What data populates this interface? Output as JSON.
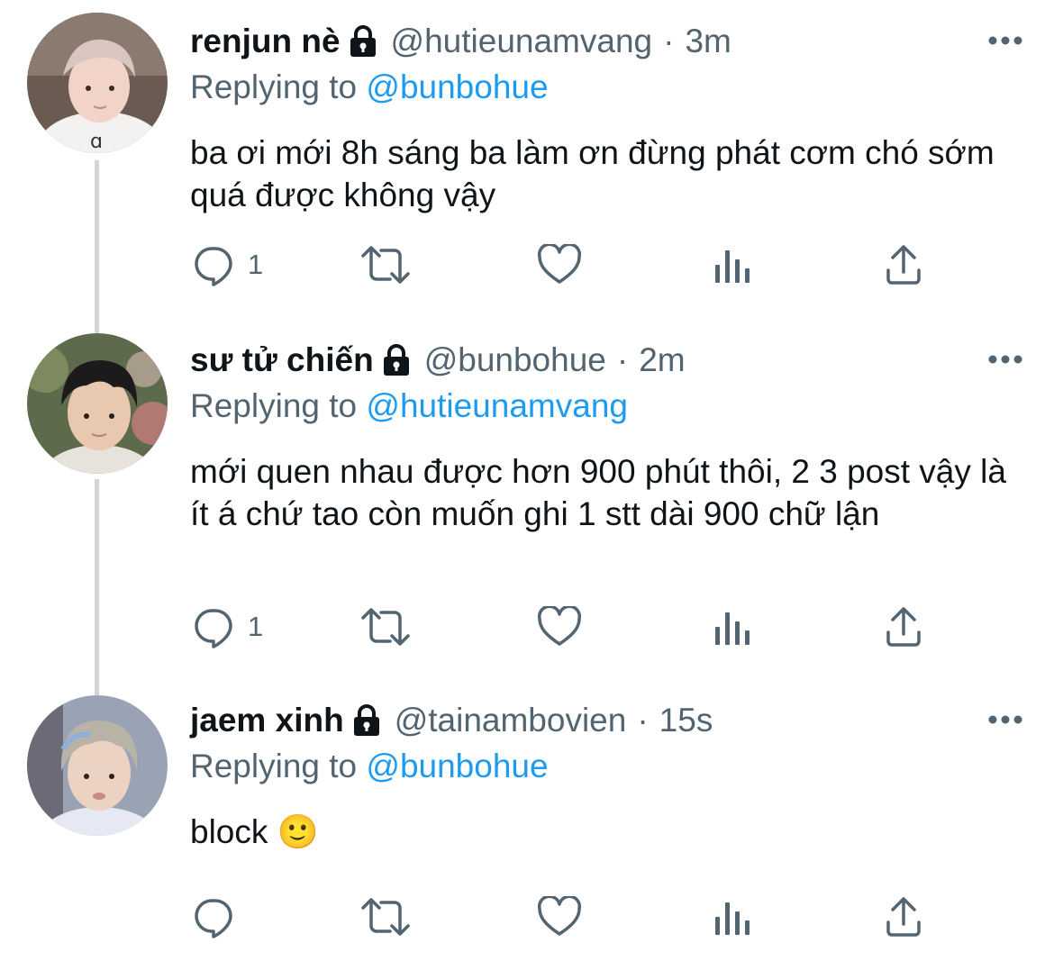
{
  "tweets": [
    {
      "display_name": "renjun nè",
      "handle": "@hutieunamvang",
      "dot": "·",
      "time": "3m",
      "replying_prefix": "Replying to",
      "replying_to": "@bunbohue",
      "text": "ba ơi mới 8h sáng ba làm ơn đừng phát cơm chó sớm quá được không vậy",
      "reply_count": "1",
      "avatar_colors": {
        "bg": "#6b5a52",
        "skin": "#f1d3c8",
        "hair": "#d9c7bf",
        "shirt": "#f4f2f0"
      }
    },
    {
      "display_name": "sư tử chiến",
      "handle": "@bunbohue",
      "dot": "·",
      "time": "2m",
      "replying_prefix": "Replying to",
      "replying_to": "@hutieunamvang",
      "text": "mới quen nhau được hơn 900 phút thôi, 2 3 post vậy là ít á chứ tao còn muốn ghi 1 stt dài 900 chữ lận",
      "reply_count": "1",
      "avatar_colors": {
        "bg": "#5d6a4c",
        "skin": "#e8c9b0",
        "hair": "#1c1a1b",
        "shirt": "#e8e2dc"
      }
    },
    {
      "display_name": "jaem xinh",
      "handle": "@tainambovien",
      "dot": "·",
      "time": "15s",
      "replying_prefix": "Replying to",
      "replying_to": "@bunbohue",
      "text": "block 🙂",
      "reply_count": "",
      "avatar_colors": {
        "bg": "#9aa3b4",
        "skin": "#ecd2c2",
        "hair": "#b9b2a6",
        "shirt": "#e6e9f3"
      }
    }
  ],
  "icons": {
    "lock": "lock-icon",
    "more": "more-icon",
    "reply": "reply-icon",
    "retweet": "retweet-icon",
    "like": "heart-icon",
    "analytics": "analytics-icon",
    "share": "share-icon"
  },
  "colors": {
    "text": "#0f1419",
    "secondary": "#536471",
    "link": "#1d9bf0",
    "thread_line": "#d0d5d9"
  }
}
